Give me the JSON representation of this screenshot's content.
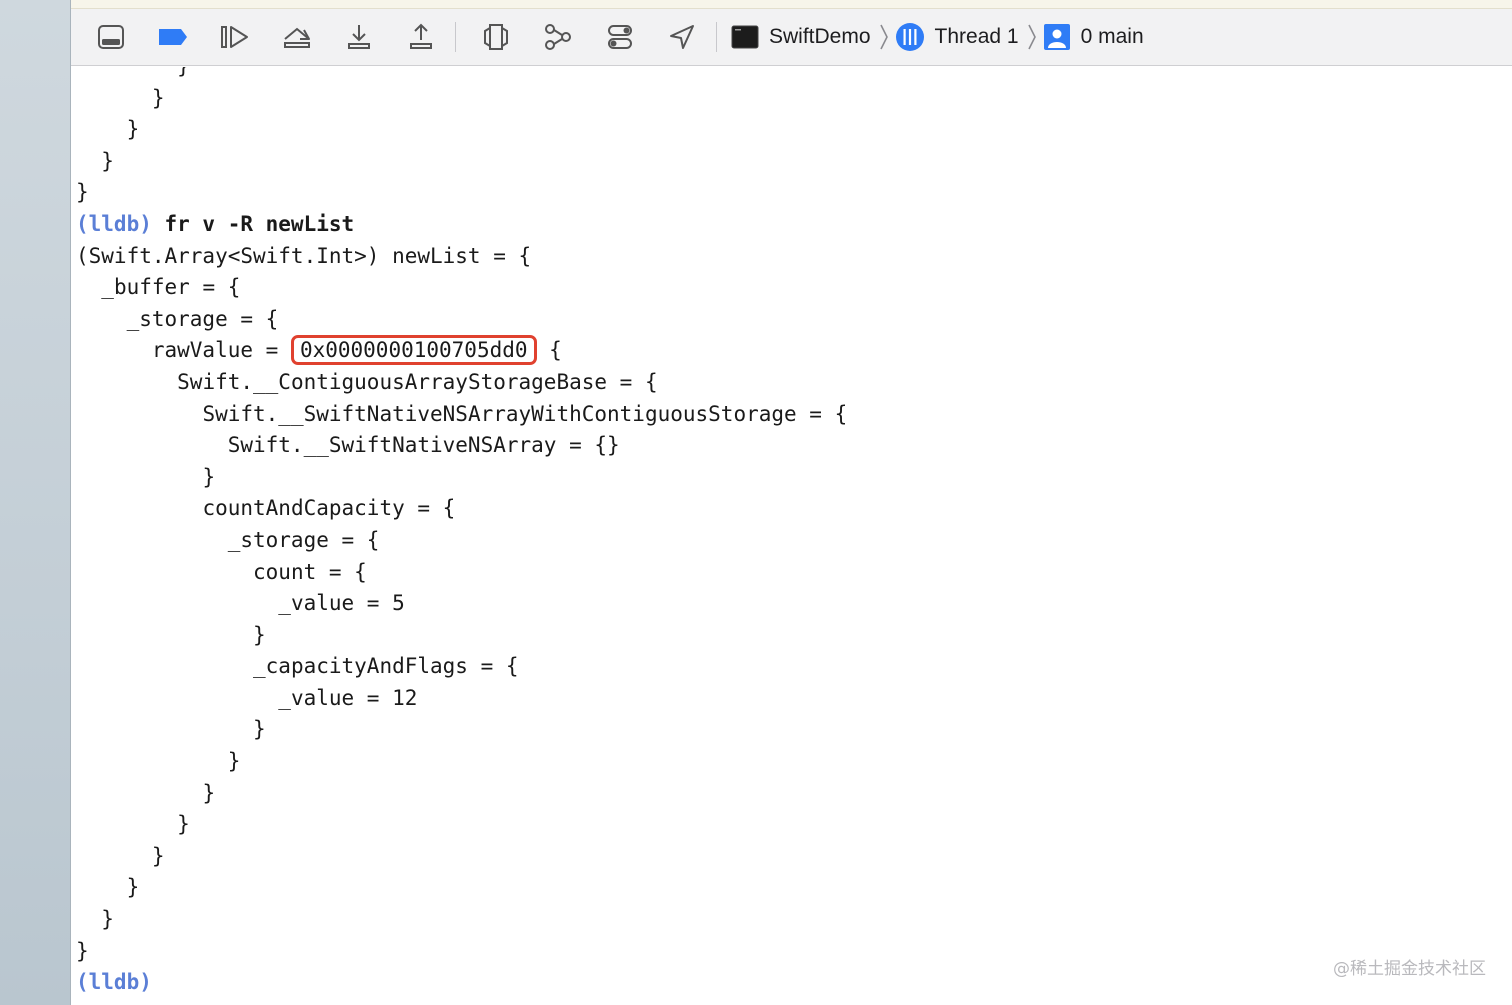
{
  "toolbar": {
    "buttons": [
      {
        "id": "hide-debug-area",
        "icon": "debug-area-icon"
      },
      {
        "id": "breakpoints",
        "icon": "breakpoint-icon"
      },
      {
        "id": "continue",
        "icon": "continue-icon"
      },
      {
        "id": "step-over",
        "icon": "step-over-icon"
      },
      {
        "id": "step-into",
        "icon": "step-into-icon"
      },
      {
        "id": "step-out",
        "icon": "step-out-icon"
      },
      {
        "id": "view-hierarchy",
        "icon": "view-hierarchy-icon"
      },
      {
        "id": "memory-graph",
        "icon": "memory-graph-icon"
      },
      {
        "id": "environment-overrides",
        "icon": "environment-overrides-icon"
      },
      {
        "id": "simulate-location",
        "icon": "location-icon"
      }
    ],
    "breadcrumbs": [
      {
        "label": "SwiftDemo",
        "icon": "terminal-app-icon"
      },
      {
        "label": "Thread 1",
        "icon": "thread-icon"
      },
      {
        "label": "0 main",
        "icon": "stack-frame-icon"
      }
    ]
  },
  "console": {
    "lines": [
      {
        "indent": "        ",
        "text": "}",
        "partial": true
      },
      {
        "indent": "      ",
        "text": "}"
      },
      {
        "indent": "    ",
        "text": "}"
      },
      {
        "indent": "  ",
        "text": "}"
      },
      {
        "indent": "",
        "text": "}"
      },
      {
        "prompt": "(lldb)",
        "command": " fr v -R newList"
      },
      {
        "indent": "",
        "text": "(Swift.Array<Swift.Int>) newList = {"
      },
      {
        "indent": "  ",
        "text": "_buffer = {"
      },
      {
        "indent": "    ",
        "text": "_storage = {"
      },
      {
        "indent": "      ",
        "pre": "rawValue = ",
        "highlight": "0x0000000100705dd0",
        "post": " {"
      },
      {
        "indent": "        ",
        "text": "Swift.__ContiguousArrayStorageBase = {"
      },
      {
        "indent": "          ",
        "text": "Swift.__SwiftNativeNSArrayWithContiguousStorage = {"
      },
      {
        "indent": "            ",
        "text": "Swift.__SwiftNativeNSArray = {}"
      },
      {
        "indent": "          ",
        "text": "}"
      },
      {
        "indent": "          ",
        "text": "countAndCapacity = {"
      },
      {
        "indent": "            ",
        "text": "_storage = {"
      },
      {
        "indent": "              ",
        "text": "count = {"
      },
      {
        "indent": "                ",
        "text": "_value = 5"
      },
      {
        "indent": "              ",
        "text": "}"
      },
      {
        "indent": "              ",
        "text": "_capacityAndFlags = {"
      },
      {
        "indent": "                ",
        "text": "_value = 12"
      },
      {
        "indent": "              ",
        "text": "}"
      },
      {
        "indent": "            ",
        "text": "}"
      },
      {
        "indent": "          ",
        "text": "}"
      },
      {
        "indent": "        ",
        "text": "}"
      },
      {
        "indent": "      ",
        "text": "}"
      },
      {
        "indent": "    ",
        "text": "}"
      },
      {
        "indent": "  ",
        "text": "}"
      },
      {
        "indent": "",
        "text": "}"
      },
      {
        "prompt": "(lldb)",
        "command": ""
      }
    ]
  },
  "watermark": "@稀土掘金技术社区",
  "colors": {
    "prompt": "#5b7fd6",
    "highlight_border": "#e0412f",
    "toolbar_bg": "#f2f2f3",
    "accent_blue": "#2f7cf6"
  }
}
